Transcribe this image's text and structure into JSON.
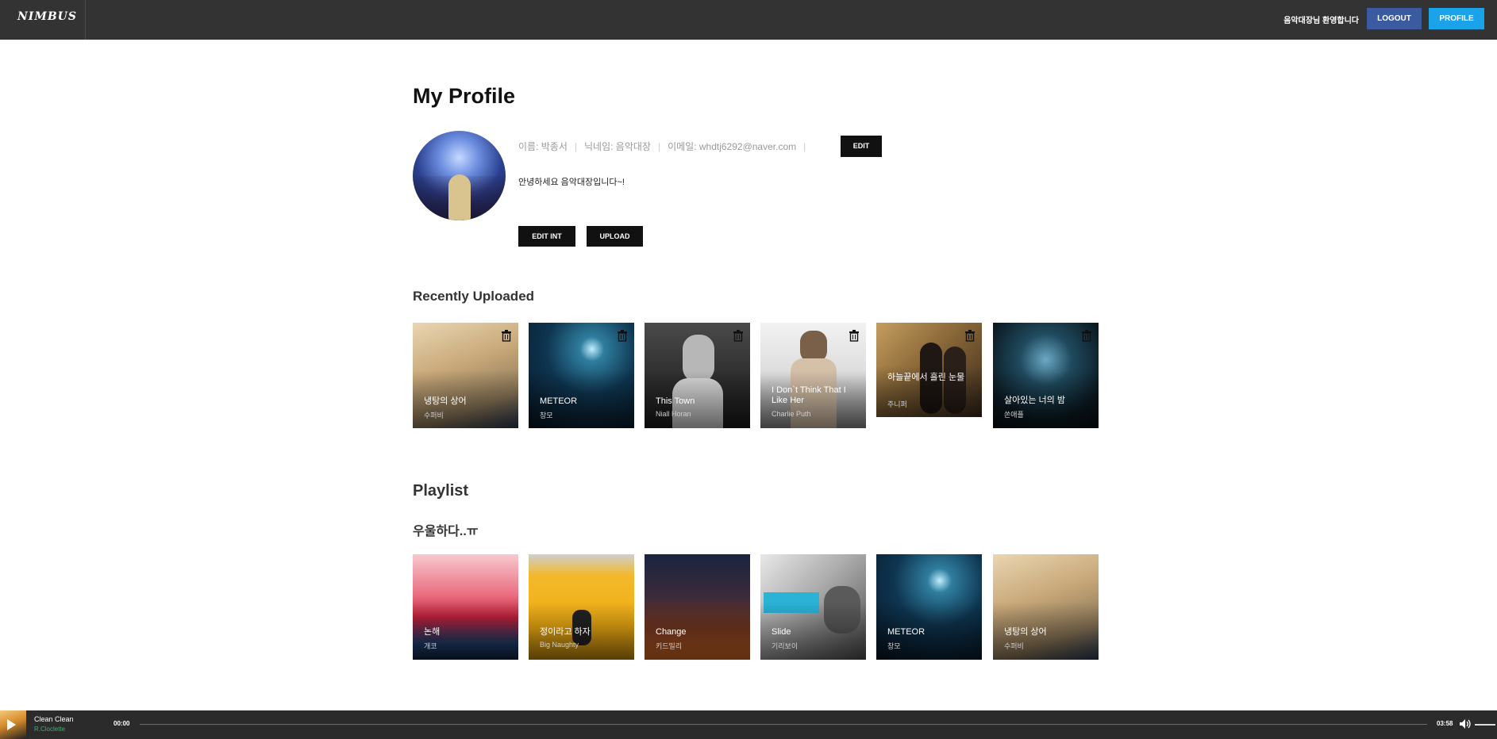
{
  "nav": {
    "logo": "NIMBUS",
    "welcome": "음악대장님 환영합니다",
    "logout_label": "LOGOUT",
    "profile_label": "PROFILE",
    "logout_color": "#3a5ba0",
    "profile_color": "#1aa3e8"
  },
  "profile": {
    "title": "My Profile",
    "name": "이름: 박종서",
    "nickname": "닉네임: 음악대장",
    "email": "이메일: whdtj6292@naver.com",
    "separator": "|",
    "edit_label": "EDIT",
    "intro": "안녕하세요 음악대장입니다~!",
    "edit_intro_label": "EDIT INT",
    "upload_label": "UPLOAD"
  },
  "recent": {
    "title": "Recently Uploaded",
    "items": [
      {
        "title": "냉탕의 상어",
        "artist": "수퍼비",
        "icon": "trash-icon"
      },
      {
        "title": "METEOR",
        "artist": "창모",
        "icon": "trash-icon"
      },
      {
        "title": "This Town",
        "artist": "Niall Horan",
        "icon": "trash-icon"
      },
      {
        "title": "I Don`t Think That I Like Her",
        "artist": "Charlie Puth",
        "icon": "trash-icon"
      },
      {
        "title": "하늘끝에서 흘린 눈물",
        "artist": "주니퍼",
        "icon": "trash-icon"
      },
      {
        "title": "살아있는 너의 밤",
        "artist": "쏜애플",
        "icon": "trash-icon"
      }
    ]
  },
  "playlist": {
    "title": "Playlist",
    "name": "우울하다..ㅠ",
    "items": [
      {
        "title": "논해",
        "artist": "개코"
      },
      {
        "title": "정이라고 하자",
        "artist": "Big Naughty"
      },
      {
        "title": "Change",
        "artist": "키드밀리"
      },
      {
        "title": "Slide",
        "artist": "기리보이"
      },
      {
        "title": "METEOR",
        "artist": "창모"
      },
      {
        "title": "냉탕의 상어",
        "artist": "수퍼비"
      }
    ]
  },
  "player": {
    "song": "Clean Clean",
    "artist": "R.Cloclette",
    "current_time": "00:00",
    "duration": "03:58",
    "progress": 0,
    "accent": "#3fae6e",
    "play_icon": "play-icon",
    "volume_icon": "volume-icon"
  }
}
